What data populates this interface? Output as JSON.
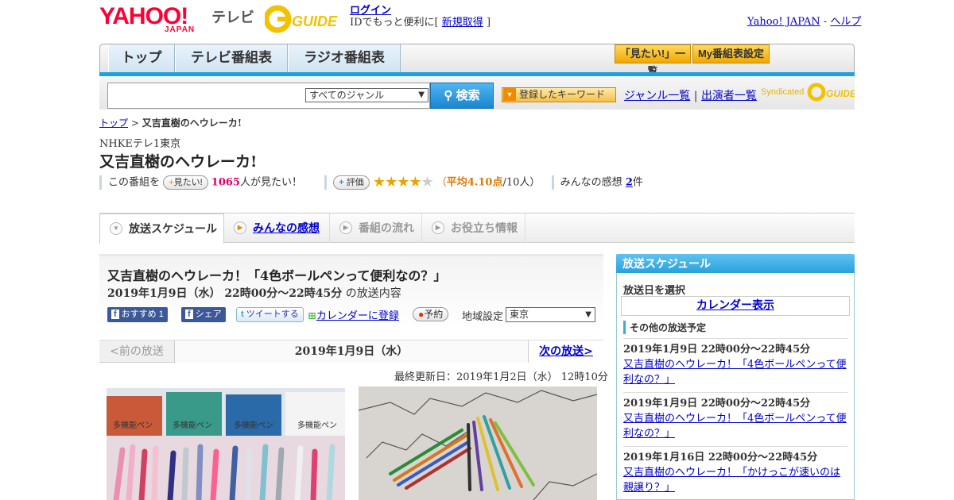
{
  "header": {
    "yahoo_logo": "YAHOO!",
    "yahoo_sub": "JAPAN",
    "tv_label": "テレビ",
    "gguide_logo": "G-GUIDE",
    "login": "ログイン",
    "login_sub_before": "IDでもっと便利に[",
    "register": "新規取得",
    "login_sub_after": "]",
    "yahoo_japan_link": "Yahoo! JAPAN",
    "sep": "-",
    "help_link": "ヘルプ"
  },
  "nav": {
    "tabs": [
      "トップ",
      "テレビ番組表",
      "ラジオ番組表"
    ],
    "mitai_list": "「見たい!」一覧",
    "my_table": "My番組表設定"
  },
  "search": {
    "genre": "すべてのジャンル",
    "button": "検索",
    "keyword_btn": "登録したキーワード",
    "genre_list": "ジャンル一覧",
    "divider": "|",
    "cast_list": "出演者一覧",
    "syndicated": "Syndicated"
  },
  "breadcrumb": {
    "top": "トップ",
    "sep": ">",
    "current": "又吉直樹のヘウレーカ!"
  },
  "program": {
    "channel": "NHKEテレ1東京",
    "title": "又吉直樹のヘウレーカ!",
    "want_prefix": "この番組を",
    "want_btn": "見たい!",
    "want_count": "1065",
    "want_suffix": "人が見たい！",
    "rate_btn": "評価",
    "rating_stars_filled": 4,
    "rating_avg_prefix": "（",
    "rating_avg": "平均4.10点",
    "rating_count": "/10人）",
    "impressions_label": "みんなの感想",
    "impressions_count": "2",
    "impressions_unit": "件"
  },
  "tabs": [
    {
      "label": "放送スケジュール",
      "active": true
    },
    {
      "label": "みんなの感想",
      "active": false,
      "link": true
    },
    {
      "label": "番組の流れ",
      "active": false
    },
    {
      "label": "お役立ち情報",
      "active": false
    }
  ],
  "episode": {
    "title": "又吉直樹のヘウレーカ！「4色ボールペンって便利なの？」",
    "time": "2019年1月9日（水） 22時00分～22時45分",
    "time_suffix": "の放送内容",
    "fb_recommend": "おすすめ 1",
    "fb_share": "シェア",
    "tweet": "ツイートする",
    "calendar": "カレンダーに登録",
    "reserve": "予約",
    "region_label": "地域設定",
    "region": "東京"
  },
  "pager": {
    "prev": "<前の放送",
    "current": "2019年1月9日（水）",
    "next": "次の放送>"
  },
  "updated": "最終更新日：2019年1月2日（水） 12時10分",
  "photo_labels": [
    "多機能ペン",
    "多機能ペン",
    "多機能ペン",
    "多機能ペン"
  ],
  "sidebar": {
    "head": "放送スケジュール",
    "date_label": "放送日を選択",
    "calendar": "カレンダー表示",
    "other_label": "その他の放送予定",
    "items": [
      {
        "time": "2019年1月9日 22時00分～22時45分",
        "title": "又吉直樹のヘウレーカ！「4色ボールペンって便利なの？」"
      },
      {
        "time": "2019年1月9日 22時00分～22時45分",
        "title": "又吉直樹のヘウレーカ！「4色ボールペンって便利なの？」"
      },
      {
        "time": "2019年1月16日 22時00分～22時45分",
        "title": "又吉直樹のヘウレーカ！「かけっこが速いのは親譲り？」"
      }
    ]
  },
  "colors": {
    "accent_blue": "#1ea0e6",
    "star": "#e8a400",
    "want_count": "#e0006a",
    "rating": "#e07800"
  }
}
